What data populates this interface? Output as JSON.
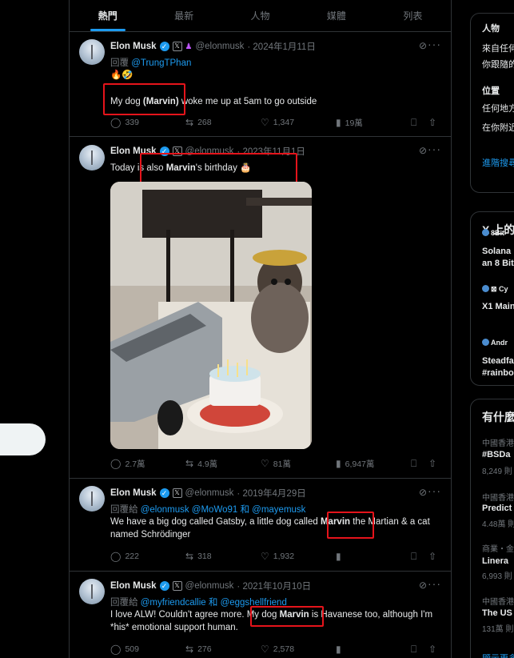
{
  "tabs": [
    "熱門",
    "最新",
    "人物",
    "媒體",
    "列表"
  ],
  "tweets": [
    {
      "name": "Elon Musk",
      "handle": "@elonmusk",
      "date": "· 2024年1月11日",
      "reply_prefix": "回覆",
      "reply_to": "@TrungTPhan",
      "emoji_line": "🔥🤣",
      "body_pre": "My dog ",
      "body_bold": "(Marvin)",
      "body_post": " woke me up at 5am to go outside",
      "replies": "339",
      "retweets": "268",
      "likes": "1,347",
      "views": "19萬"
    },
    {
      "name": "Elon Musk",
      "handle": "@elonmusk",
      "date": "· 2023年11月1日",
      "body_pre": "Today is also ",
      "body_bold": "Marvin",
      "body_post": "'s birthday 🎂",
      "replies": "2.7萬",
      "retweets": "4.9萬",
      "likes": "81萬",
      "views": "6,947萬"
    },
    {
      "name": "Elon Musk",
      "handle": "@elonmusk",
      "date": "· 2019年4月29日",
      "reply_prefix": "回覆給",
      "reply_to": "@elonmusk @MoWo91 和 @mayemusk",
      "body_pre": "We have a big dog called Gatsby, a little dog called ",
      "body_bold": "Marvin",
      "body_post": " the Martian & a cat named Schrödinger",
      "replies": "222",
      "retweets": "318",
      "likes": "1,932"
    },
    {
      "name": "Elon Musk",
      "handle": "@elonmusk",
      "date": "· 2021年10月10日",
      "reply_prefix": "回覆給",
      "reply_to": "@myfriendcallie 和 @eggshellfriend",
      "body_pre": "I love ALW! Couldn't agree more. My dog ",
      "body_bold": "Marvin",
      "body_post": " is Havanese too, although I'm *his* emotional support human.",
      "replies": "509",
      "retweets": "276",
      "likes": "2,578"
    }
  ],
  "sidebar": {
    "filter_people": "人物",
    "filter_people_opt1": "來自任何",
    "filter_people_opt2": "你跟隨的",
    "filter_location": "位置",
    "filter_location_opt1": "任何地方",
    "filter_location_opt2": "在你附近",
    "advanced": "進階搜尋",
    "x_title": "X 上的",
    "items": [
      {
        "user": "8Bit",
        "line1": "Solana",
        "line2": "an 8 Bit"
      },
      {
        "user": "Cy",
        "line1": "X1 Main"
      },
      {
        "user": "Andr",
        "line1": "Steadfa",
        "line2": "#rainbo"
      }
    ],
    "trend_title": "有什麼",
    "trends": [
      {
        "meta": "中國香港",
        "name": "#BSDa",
        "count": "8,249 則"
      },
      {
        "meta": "中國香港",
        "name": "Predict",
        "count": "4.48萬 則"
      },
      {
        "meta": "商業・金",
        "name": "Linera",
        "count": "6,993 則"
      },
      {
        "meta": "中國香港",
        "name": "The US",
        "count": "131萬 則"
      }
    ],
    "show_more": "顯示更多"
  },
  "colors": {
    "accent": "#1d9bf0",
    "annotation": "#e5141b",
    "bg": "#000000"
  }
}
